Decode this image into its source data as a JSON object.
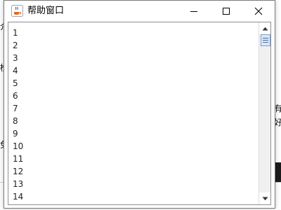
{
  "window": {
    "title": "帮助窗口",
    "icon": "java-coffee-icon",
    "controls": [
      "minimize-icon",
      "maximize-icon",
      "close-icon"
    ]
  },
  "textarea": {
    "lines": [
      "1",
      "2",
      "3",
      "4",
      "5",
      "6",
      "7",
      "8",
      "9",
      "10",
      "11",
      "12",
      "13",
      "14"
    ]
  },
  "background": {
    "fragments": [
      "介",
      "检",
      "有",
      "好",
      "免"
    ]
  },
  "colors": {
    "accent_thumb": "#dbe7f7",
    "thumb_border": "#7aa0d3",
    "window_border": "#7a7a7a"
  }
}
